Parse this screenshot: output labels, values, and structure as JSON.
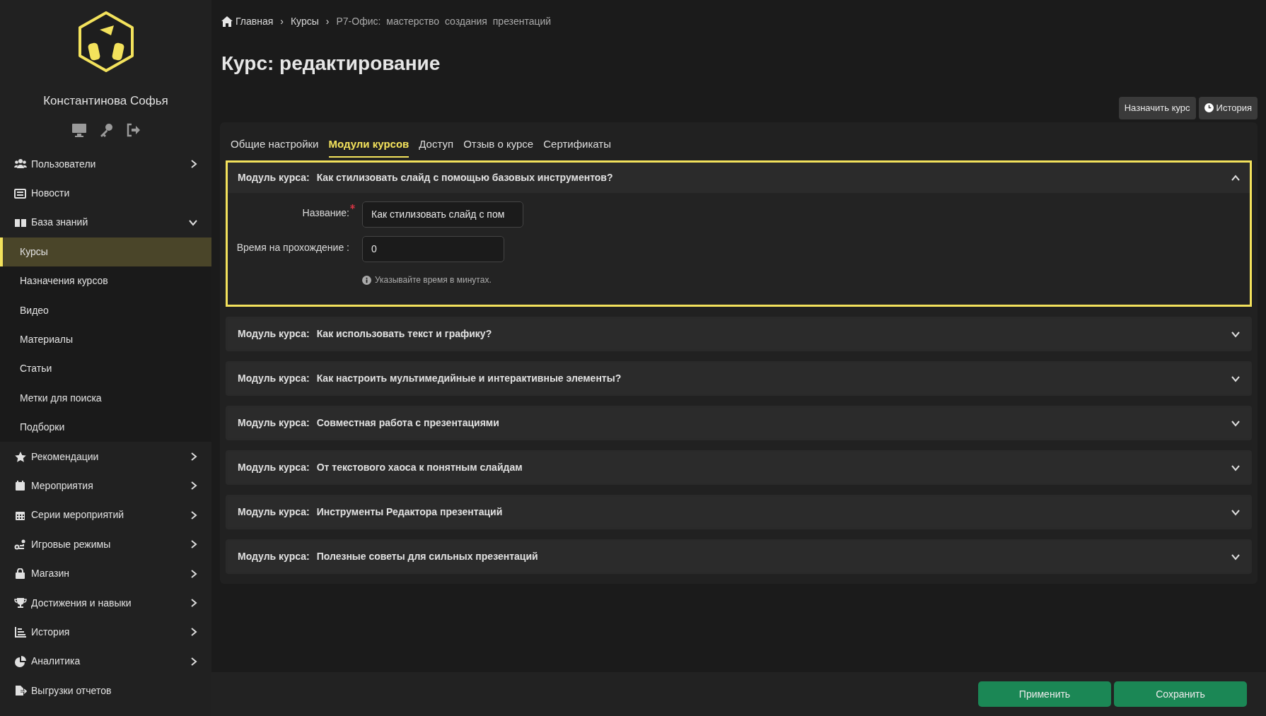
{
  "sidebar": {
    "user_name": "Константинова Софья",
    "items": [
      {
        "label": "Пользователи",
        "expanded": false,
        "selected": false
      },
      {
        "label": "Новости",
        "selected": false
      },
      {
        "label": "База знаний",
        "expanded": true,
        "selected": false,
        "children": [
          {
            "label": "Курсы",
            "selected": true
          },
          {
            "label": "Назначения курсов",
            "selected": false
          },
          {
            "label": "Видео",
            "selected": false
          },
          {
            "label": "Материалы",
            "selected": false
          },
          {
            "label": "Статьи",
            "selected": false
          },
          {
            "label": "Метки для поиска",
            "selected": false
          },
          {
            "label": "Подборки",
            "selected": false
          }
        ]
      },
      {
        "label": "Рекомендации",
        "expanded": false,
        "selected": false
      },
      {
        "label": "Мероприятия",
        "expanded": false,
        "selected": false
      },
      {
        "label": "Серии мероприятий",
        "expanded": false,
        "selected": false
      },
      {
        "label": "Игровые режимы",
        "expanded": false,
        "selected": false
      },
      {
        "label": "Магазин",
        "expanded": false,
        "selected": false
      },
      {
        "label": "Достижения и навыки",
        "expanded": false,
        "selected": false
      },
      {
        "label": "История",
        "expanded": false,
        "selected": false
      },
      {
        "label": "Аналитика",
        "expanded": false,
        "selected": false
      },
      {
        "label": "Выгрузки отчетов",
        "selected": false
      }
    ]
  },
  "breadcrumb": {
    "separator": "›",
    "items": [
      "Главная",
      "Курсы",
      "Р7-Офис: мастерство создания презентаций"
    ]
  },
  "page_title": "Курс: редактирование",
  "header_buttons": [
    "Назначить курс",
    "История"
  ],
  "tabs": [
    {
      "label": "Общие настройки",
      "selected": false
    },
    {
      "label": "Модули курсов",
      "selected": true
    },
    {
      "label": "Доступ",
      "selected": false
    },
    {
      "label": "Отзыв о курсе",
      "selected": false
    },
    {
      "label": "Сертификаты",
      "selected": false
    }
  ],
  "modules": [
    {
      "label": "Модуль курса:",
      "title": "Как стилизовать слайд с помощью базовых инструментов?",
      "expanded": true,
      "fields": [
        {
          "label": "Название:",
          "required": true,
          "value": "Как стилизовать слайд с пом"
        },
        {
          "label": "Время на прохождение :",
          "required": false,
          "value": "0",
          "hint": "Указывайте время в минутах."
        }
      ]
    },
    {
      "label": "Модуль курса:",
      "title": "Как использовать текст и графику?",
      "expanded": false
    },
    {
      "label": "Модуль курса:",
      "title": "Как настроить мультимедийные и интерактивные элементы?",
      "expanded": false
    },
    {
      "label": "Модуль курса:",
      "title": "Совместная работа с презентациями",
      "expanded": false
    },
    {
      "label": "Модуль курса:",
      "title": "От текстового хаоса к понятным слайдам",
      "expanded": false
    },
    {
      "label": "Модуль курса:",
      "title": "Инструменты Редактора презентаций",
      "expanded": false
    },
    {
      "label": "Модуль курса:",
      "title": "Полезные советы для сильных презентаций",
      "expanded": false
    }
  ],
  "footer_buttons": [
    "Применить",
    "Сохранить"
  ]
}
